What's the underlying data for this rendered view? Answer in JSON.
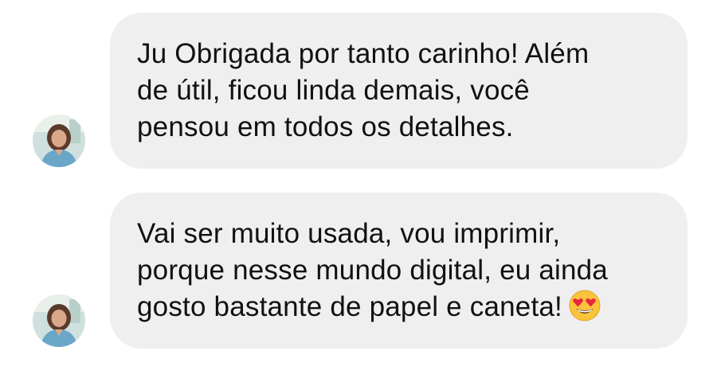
{
  "messages": [
    {
      "lines": [
        "Ju Obrigada por tanto carinho!  Além",
        "de útil, ficou linda demais, você",
        "pensou em todos os detalhes."
      ],
      "avatar_icon": "profile-photo"
    },
    {
      "lines": [
        "Vai ser muito usada, vou imprimir,",
        "porque nesse mundo digital, eu ainda",
        "gosto bastante de papel e caneta!"
      ],
      "emoji_icon": "heart-eyes-emoji",
      "avatar_icon": "profile-photo"
    }
  ],
  "colors": {
    "bubble_bg": "#efefef",
    "text": "#111111",
    "emoji_face": "#f9c33c",
    "emoji_hearts": "#e8283e"
  }
}
